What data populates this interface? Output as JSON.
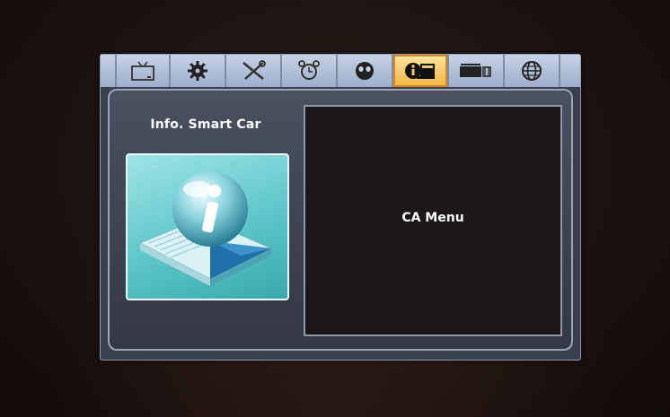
{
  "tabs": [
    {
      "icon": "tv-icon",
      "active": false
    },
    {
      "icon": "gear-icon",
      "active": false
    },
    {
      "icon": "tools-icon",
      "active": false
    },
    {
      "icon": "alarm-clock-icon",
      "active": false
    },
    {
      "icon": "face-icon",
      "active": false
    },
    {
      "icon": "info-card-icon",
      "active": true
    },
    {
      "icon": "battery-icon",
      "active": false
    },
    {
      "icon": "globe-icon",
      "active": false
    }
  ],
  "left_panel": {
    "title": "Info. Smart Car",
    "icon": "info-book-icon"
  },
  "right_panel": {
    "label": "CA Menu"
  },
  "colors": {
    "active_tab": "#f2b540",
    "icon_box": "#5cc6c9",
    "panel": "#3a3f4c"
  }
}
